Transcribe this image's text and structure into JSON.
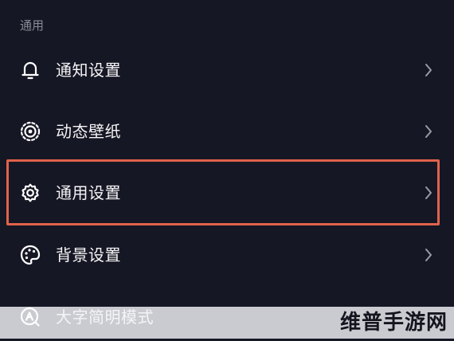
{
  "section": {
    "title": "通用"
  },
  "items": [
    {
      "label": "通知设置",
      "icon": "bell-icon"
    },
    {
      "label": "动态壁纸",
      "icon": "live-wallpaper-icon"
    },
    {
      "label": "通用设置",
      "icon": "gear-icon"
    },
    {
      "label": "背景设置",
      "icon": "palette-icon"
    },
    {
      "label": "大字简明模式",
      "icon": "large-text-icon"
    }
  ],
  "watermark": {
    "text": "维普手游网"
  },
  "colors": {
    "background": "#161724",
    "highlight_border": "#e0634b",
    "section_title": "#8a8b96",
    "bottom_band": "#cacbd0"
  }
}
